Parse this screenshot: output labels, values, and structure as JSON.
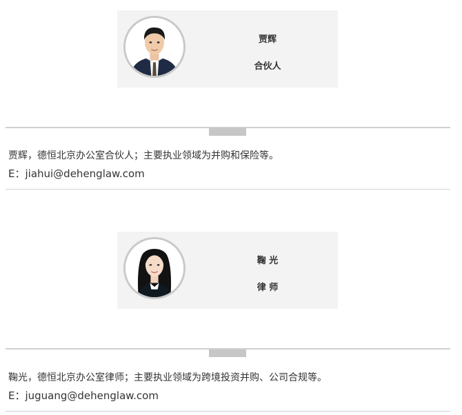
{
  "profiles": [
    {
      "name": "贾辉",
      "title": "合伙人",
      "bio": "贾辉，德恒北京办公室合伙人；主要执业领域为并购和保险等。",
      "email": "E：jiahui@dehenglaw.com"
    },
    {
      "name": "鞠 光",
      "title": "律 师",
      "bio": "鞠光，德恒北京办公室律师；主要执业领域为跨境投资并购、公司合规等。",
      "email": "E：juguang@dehenglaw.com"
    }
  ],
  "colors": {
    "card_bg": "#f3f3f3",
    "divider": "#cfcfcf",
    "tab": "#c6c6c6",
    "text": "#333333"
  }
}
